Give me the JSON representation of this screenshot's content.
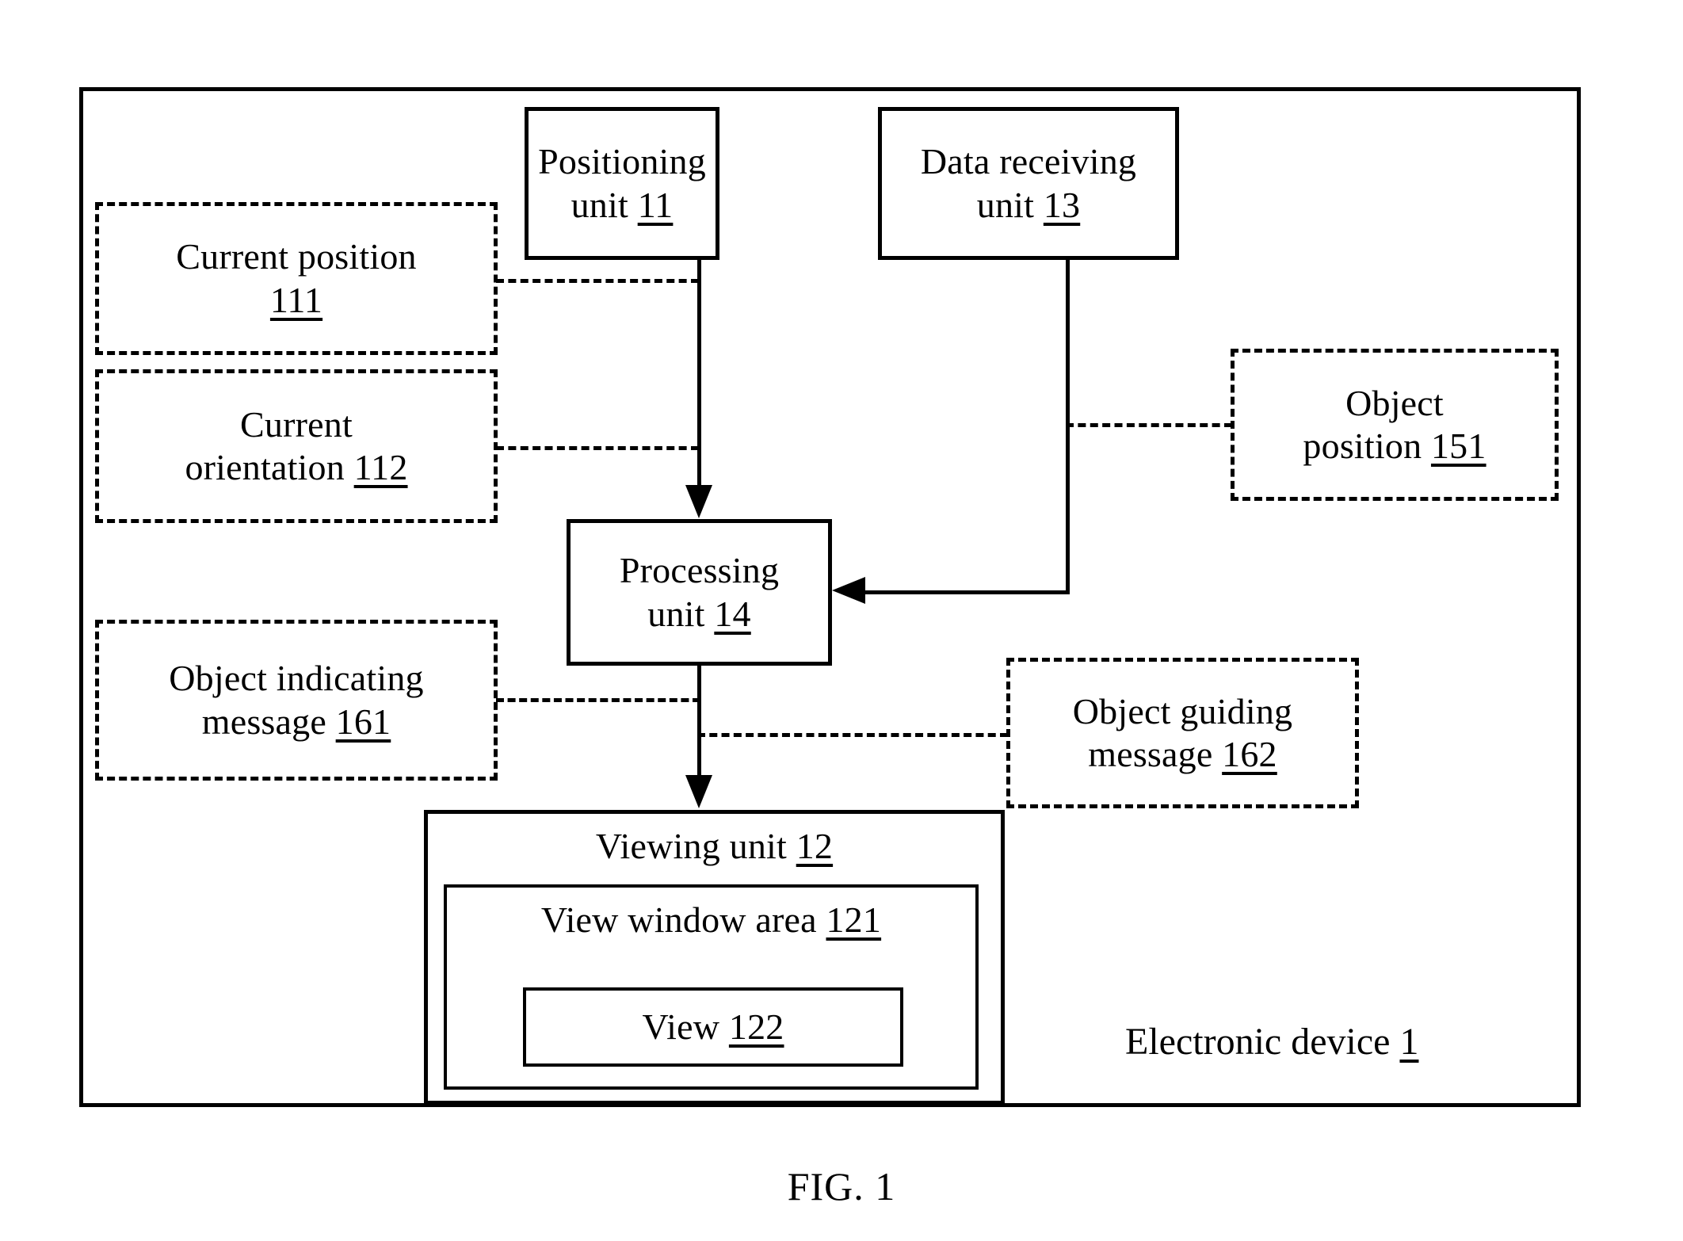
{
  "figure": {
    "caption": "FIG. 1",
    "outer_container_label": "Electronic device",
    "outer_container_ref": "1"
  },
  "blocks": {
    "positioning_unit": {
      "line1": "Positioning",
      "line2": "unit",
      "ref": "11",
      "style": "solid"
    },
    "data_receiving_unit": {
      "line1": "Data receiving",
      "line2": "unit",
      "ref": "13",
      "style": "solid"
    },
    "processing_unit": {
      "line1": "Processing",
      "line2": "unit",
      "ref": "14",
      "style": "solid"
    },
    "viewing_unit": {
      "line1": "Viewing unit",
      "ref": "12",
      "style": "solid"
    },
    "view_window_area": {
      "line1": "View window area",
      "ref": "121",
      "style": "solid"
    },
    "view": {
      "line1": "View",
      "ref": "122",
      "style": "solid"
    },
    "current_position": {
      "line1": "Current position",
      "ref": "111",
      "style": "dashed"
    },
    "current_orientation": {
      "line1": "Current",
      "line2": "orientation",
      "ref": "112",
      "style": "dashed"
    },
    "object_position": {
      "line1": "Object",
      "line2": "position",
      "ref": "151",
      "style": "dashed"
    },
    "object_indicating_message": {
      "line1": "Object indicating",
      "line2": "message",
      "ref": "161",
      "style": "dashed"
    },
    "object_guiding_message": {
      "line1": "Object guiding",
      "line2": "message",
      "ref": "162",
      "style": "dashed"
    }
  },
  "colors": {
    "stroke": "#000000",
    "background": "#ffffff"
  }
}
